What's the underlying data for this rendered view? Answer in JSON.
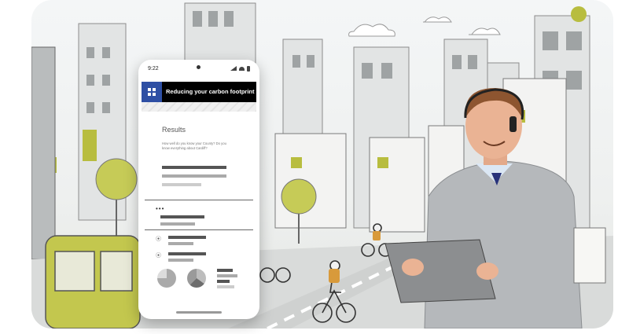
{
  "phone": {
    "status_time": "9:22",
    "app_title": "Reducing your carbon footprint",
    "app_icon": "grid-icon",
    "results_heading": "Results",
    "results_question": "How well do you know your County? Do you know everything about Cardiff?"
  },
  "icons": {
    "location_pin": "location-pin-icon",
    "more": "more-dots-icon"
  },
  "colors": {
    "app_accent": "#2e4fa4",
    "app_bar": "#000000",
    "scene_accent": "#b8bd3f"
  }
}
